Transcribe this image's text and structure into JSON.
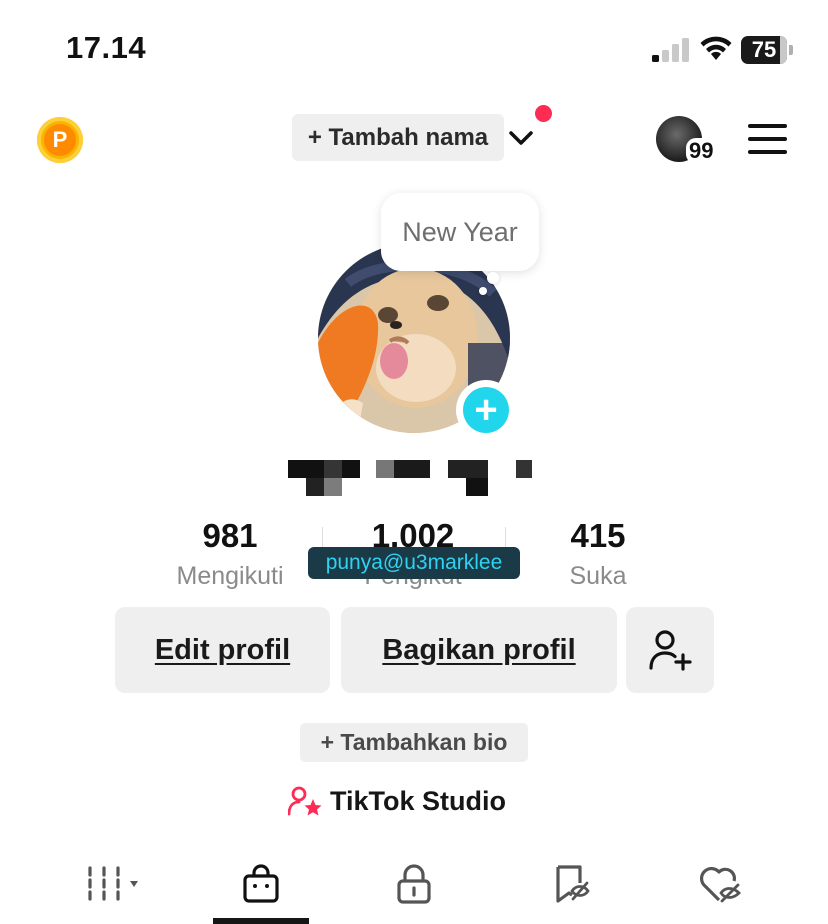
{
  "status_bar": {
    "time": "17.14",
    "battery": "75",
    "icons": [
      "cellular-signal-icon",
      "wifi-icon",
      "battery-icon"
    ]
  },
  "header": {
    "coin_letter": "P",
    "add_name_label": "+ Tambah nama",
    "friends_count": "99",
    "accent_color": "#fe2c55"
  },
  "profile": {
    "mood_label": "New Year",
    "username_overlay": "punya@u3marklee",
    "stats": [
      {
        "value": "981",
        "label": "Mengikuti"
      },
      {
        "value": "1.002",
        "label": "Pengikut"
      },
      {
        "value": "415",
        "label": "Suka"
      }
    ],
    "buttons": {
      "edit": "Edit profil",
      "share": "Bagikan profil"
    },
    "bio_label": "+ Tambahkan bio",
    "studio_label": "TikTok Studio"
  },
  "tabs": [
    {
      "name": "videos-grid-icon",
      "active": false
    },
    {
      "name": "shop-bag-icon",
      "active": true
    },
    {
      "name": "lock-icon",
      "active": false
    },
    {
      "name": "favorites-icon",
      "active": false
    },
    {
      "name": "liked-hidden-icon",
      "active": false
    }
  ],
  "colors": {
    "accent_cyan": "#20d5ec",
    "accent_red": "#fe2c55",
    "coin": "#f7b500"
  }
}
